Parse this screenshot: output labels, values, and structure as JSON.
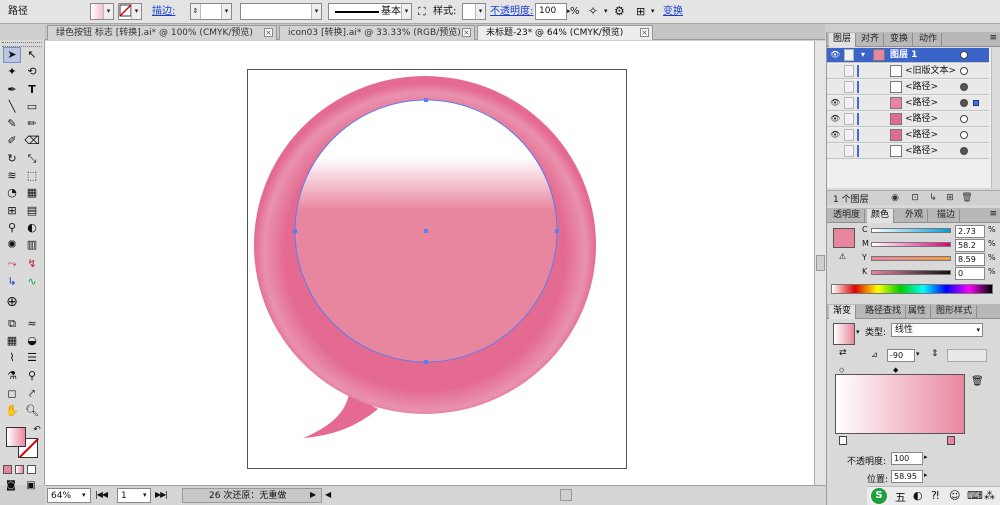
{
  "control_bar": {
    "selection_type": "路径",
    "stroke_label": "描边:",
    "stroke_profile": "基本",
    "style_label": "样式:",
    "opacity_label": "不透明度:",
    "opacity_value": "100",
    "opacity_unit": "%",
    "transform_label": "变换"
  },
  "tabs": [
    {
      "label": "绿色按钮 标志 [转换].ai* @ 100% (CMYK/预览)"
    },
    {
      "label": "icon03 [转换].ai* @ 33.33% (RGB/预览)"
    },
    {
      "label": "未标题-23* @ 64% (CMYK/预览)"
    }
  ],
  "status_bar": {
    "zoom": "64%",
    "page": "1",
    "status_text": "26 次还原：无重做"
  },
  "layers_panel": {
    "tabs": [
      "图层",
      "对齐",
      "变换",
      "动作"
    ],
    "rows": [
      {
        "name": "图层 1",
        "thumb_color": "#e9869f"
      },
      {
        "name": "<旧版文本>",
        "thumb_color": "#ffffff"
      },
      {
        "name": "<路径>",
        "thumb_color": "#ffffff"
      },
      {
        "name": "<路径>",
        "thumb_color": "#e9869f"
      },
      {
        "name": "<路径>",
        "thumb_color": "#e46a92"
      },
      {
        "name": "<路径>",
        "thumb_color": "#e46a92"
      },
      {
        "name": "<路径>",
        "thumb_color": "#ffffff"
      }
    ],
    "footer": "1 个图层"
  },
  "color_panel": {
    "tabs": [
      "透明度",
      "颜色",
      "外观",
      "描边"
    ],
    "channels": [
      {
        "label": "C",
        "value": "2.73"
      },
      {
        "label": "M",
        "value": "58.2"
      },
      {
        "label": "Y",
        "value": "8.59"
      },
      {
        "label": "K",
        "value": "0"
      }
    ],
    "unit": "%",
    "swatch_color": "#e9869f"
  },
  "gradient_panel": {
    "tabs": [
      "渐变",
      "路径查找",
      "属性",
      "图形样式"
    ],
    "type_label": "类型:",
    "type_value": "线性",
    "angle_value": "-90",
    "opacity_label": "不透明度:",
    "opacity_value": "100",
    "location_label": "位置:",
    "location_value": "58.95",
    "start_color": "#ffffff",
    "end_color": "#e9869f"
  },
  "colors": {
    "bubble_outer": "#e46a92",
    "bubble_inner": "#e9869f",
    "selection": "#5b7ef0"
  }
}
